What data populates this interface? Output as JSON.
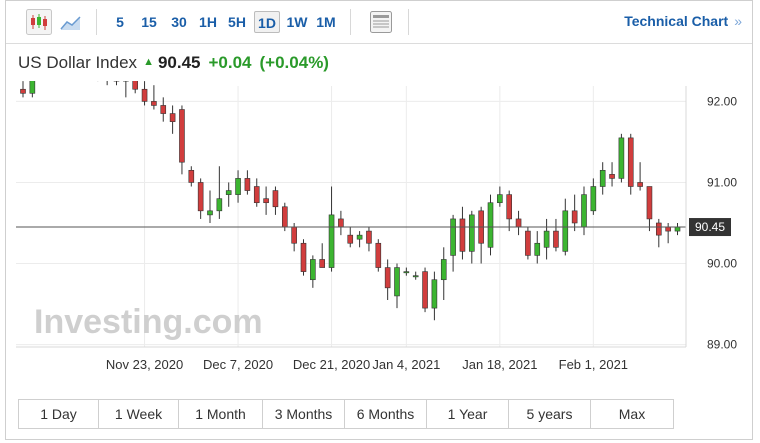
{
  "toolbar": {
    "intervals": [
      "5",
      "15",
      "30",
      "1H",
      "5H",
      "1D",
      "1W",
      "1M"
    ],
    "active_interval": "1D",
    "technical_chart_label": "Technical Chart",
    "technical_chart_arrow": "»"
  },
  "quote": {
    "name": "US Dollar Index",
    "last": "90.45",
    "change": "+0.04",
    "change_pct": "(+0.04%)",
    "up_color": "#2a9a2a"
  },
  "ranges": [
    "1 Day",
    "1 Week",
    "1 Month",
    "3 Months",
    "6 Months",
    "1 Year",
    "5 years",
    "Max"
  ],
  "chart_data": {
    "type": "candlestick",
    "y_ticks": [
      "92.00",
      "91.00",
      "90.00",
      "89.00"
    ],
    "ylim": [
      88.97,
      92.19
    ],
    "x_ticks": [
      "Nov 23, 2020",
      "Dec 7, 2020",
      "Dec 21, 2020",
      "Jan 4, 2021",
      "Jan 18, 2021",
      "Feb 1, 2021"
    ],
    "current_price_label": "90.45",
    "current_price": 90.45,
    "watermark": "Investing.com",
    "up_color": "#3cb531",
    "down_color": "#d13d3d",
    "candles": [
      {
        "date": "Nov 4, 2020",
        "o": 92.15,
        "h": 92.25,
        "l": 92.05,
        "c": 92.1
      },
      {
        "date": "Nov 5, 2020",
        "o": 92.1,
        "h": 92.85,
        "l": 92.05,
        "c": 92.6
      },
      {
        "date": "Nov 6, 2020",
        "o": 92.65,
        "h": 92.9,
        "l": 92.55,
        "c": 92.65
      },
      {
        "date": "Nov 9, 2020",
        "o": 92.65,
        "h": 93.05,
        "l": 92.55,
        "c": 92.9
      },
      {
        "date": "Nov 10, 2020",
        "o": 92.95,
        "h": 93.05,
        "l": 92.8,
        "c": 92.85
      },
      {
        "date": "Nov 11, 2020",
        "o": 92.85,
        "h": 92.95,
        "l": 92.6,
        "c": 92.65
      },
      {
        "date": "Nov 12, 2020",
        "o": 92.65,
        "h": 92.75,
        "l": 92.4,
        "c": 92.5
      },
      {
        "date": "Nov 13, 2020",
        "o": 92.5,
        "h": 92.6,
        "l": 92.3,
        "c": 92.35
      },
      {
        "date": "Nov 16, 2020",
        "o": 92.4,
        "h": 92.45,
        "l": 92.25,
        "c": 92.3
      },
      {
        "date": "Nov 17, 2020",
        "o": 92.35,
        "h": 92.55,
        "l": 92.2,
        "c": 92.45
      },
      {
        "date": "Nov 18, 2020",
        "o": 92.35,
        "h": 92.45,
        "l": 92.2,
        "c": 92.25
      },
      {
        "date": "Nov 19, 2020",
        "o": 92.25,
        "h": 92.7,
        "l": 92.05,
        "c": 92.45
      },
      {
        "date": "Nov 20, 2020",
        "o": 92.5,
        "h": 92.55,
        "l": 92.1,
        "c": 92.15
      },
      {
        "date": "Nov 23, 2020",
        "o": 92.15,
        "h": 92.25,
        "l": 91.95,
        "c": 92.0
      },
      {
        "date": "Nov 24, 2020",
        "o": 92.0,
        "h": 92.2,
        "l": 91.9,
        "c": 91.95
      },
      {
        "date": "Nov 25, 2020",
        "o": 91.95,
        "h": 92.05,
        "l": 91.75,
        "c": 91.85
      },
      {
        "date": "Nov 26, 2020",
        "o": 91.85,
        "h": 91.95,
        "l": 91.6,
        "c": 91.75
      },
      {
        "date": "Nov 27, 2020",
        "o": 91.9,
        "h": 91.95,
        "l": 91.1,
        "c": 91.25
      },
      {
        "date": "Nov 30, 2020",
        "o": 91.15,
        "h": 91.2,
        "l": 90.95,
        "c": 91.0
      },
      {
        "date": "Dec 1, 2020",
        "o": 91.0,
        "h": 91.05,
        "l": 90.55,
        "c": 90.65
      },
      {
        "date": "Dec 2, 2020",
        "o": 90.6,
        "h": 90.9,
        "l": 90.5,
        "c": 90.65
      },
      {
        "date": "Dec 3, 2020",
        "o": 90.65,
        "h": 91.2,
        "l": 90.55,
        "c": 90.8
      },
      {
        "date": "Dec 4, 2020",
        "o": 90.85,
        "h": 91.0,
        "l": 90.7,
        "c": 90.9
      },
      {
        "date": "Dec 7, 2020",
        "o": 90.85,
        "h": 91.15,
        "l": 90.75,
        "c": 91.05
      },
      {
        "date": "Dec 8, 2020",
        "o": 91.05,
        "h": 91.15,
        "l": 90.85,
        "c": 90.9
      },
      {
        "date": "Dec 9, 2020",
        "o": 90.95,
        "h": 91.05,
        "l": 90.7,
        "c": 90.75
      },
      {
        "date": "Dec 10, 2020",
        "o": 90.8,
        "h": 90.95,
        "l": 90.6,
        "c": 90.75
      },
      {
        "date": "Dec 11, 2020",
        "o": 90.9,
        "h": 90.95,
        "l": 90.6,
        "c": 90.7
      },
      {
        "date": "Dec 14, 2020",
        "o": 90.7,
        "h": 90.75,
        "l": 90.4,
        "c": 90.45
      },
      {
        "date": "Dec 15, 2020",
        "o": 90.45,
        "h": 90.5,
        "l": 90.15,
        "c": 90.25
      },
      {
        "date": "Dec 16, 2020",
        "o": 90.25,
        "h": 90.3,
        "l": 89.85,
        "c": 89.9
      },
      {
        "date": "Dec 17, 2020",
        "o": 89.8,
        "h": 90.1,
        "l": 89.7,
        "c": 90.05
      },
      {
        "date": "Dec 18, 2020",
        "o": 90.05,
        "h": 90.25,
        "l": 89.95,
        "c": 89.95
      },
      {
        "date": "Dec 21, 2020",
        "o": 89.95,
        "h": 90.95,
        "l": 89.9,
        "c": 90.6
      },
      {
        "date": "Dec 22, 2020",
        "o": 90.55,
        "h": 90.65,
        "l": 90.35,
        "c": 90.45
      },
      {
        "date": "Dec 23, 2020",
        "o": 90.35,
        "h": 90.45,
        "l": 90.2,
        "c": 90.25
      },
      {
        "date": "Dec 24, 2020",
        "o": 90.3,
        "h": 90.4,
        "l": 90.2,
        "c": 90.35
      },
      {
        "date": "Dec 28, 2020",
        "o": 90.4,
        "h": 90.45,
        "l": 90.15,
        "c": 90.25
      },
      {
        "date": "Dec 29, 2020",
        "o": 90.25,
        "h": 90.3,
        "l": 89.9,
        "c": 89.95
      },
      {
        "date": "Dec 30, 2020",
        "o": 89.95,
        "h": 90.05,
        "l": 89.55,
        "c": 89.7
      },
      {
        "date": "Dec 31, 2020",
        "o": 89.6,
        "h": 90.0,
        "l": 89.45,
        "c": 89.95
      },
      {
        "date": "Jan 4, 2021",
        "o": 89.9,
        "h": 89.95,
        "l": 89.85,
        "c": 89.9
      },
      {
        "date": "Jan 5, 2021",
        "o": 89.85,
        "h": 89.9,
        "l": 89.8,
        "c": 89.85
      },
      {
        "date": "Jan 6, 2021",
        "o": 89.9,
        "h": 89.95,
        "l": 89.4,
        "c": 89.45
      },
      {
        "date": "Jan 7, 2021",
        "o": 89.45,
        "h": 89.9,
        "l": 89.3,
        "c": 89.8
      },
      {
        "date": "Jan 8, 2021",
        "o": 89.8,
        "h": 90.2,
        "l": 89.55,
        "c": 90.05
      },
      {
        "date": "Jan 11, 2021",
        "o": 90.1,
        "h": 90.6,
        "l": 89.9,
        "c": 90.55
      },
      {
        "date": "Jan 12, 2021",
        "o": 90.55,
        "h": 90.7,
        "l": 90.05,
        "c": 90.15
      },
      {
        "date": "Jan 13, 2021",
        "o": 90.15,
        "h": 90.65,
        "l": 90.0,
        "c": 90.6
      },
      {
        "date": "Jan 14, 2021",
        "o": 90.65,
        "h": 90.7,
        "l": 90.0,
        "c": 90.25
      },
      {
        "date": "Jan 15, 2021",
        "o": 90.2,
        "h": 90.85,
        "l": 90.1,
        "c": 90.75
      },
      {
        "date": "Jan 18, 2021",
        "o": 90.75,
        "h": 90.95,
        "l": 90.7,
        "c": 90.85
      },
      {
        "date": "Jan 19, 2021",
        "o": 90.85,
        "h": 90.9,
        "l": 90.4,
        "c": 90.55
      },
      {
        "date": "Jan 20, 2021",
        "o": 90.55,
        "h": 90.65,
        "l": 90.35,
        "c": 90.45
      },
      {
        "date": "Jan 21, 2021",
        "o": 90.4,
        "h": 90.45,
        "l": 90.05,
        "c": 90.1
      },
      {
        "date": "Jan 22, 2021",
        "o": 90.1,
        "h": 90.4,
        "l": 90.0,
        "c": 90.25
      },
      {
        "date": "Jan 25, 2021",
        "o": 90.2,
        "h": 90.55,
        "l": 90.05,
        "c": 90.4
      },
      {
        "date": "Jan 26, 2021",
        "o": 90.4,
        "h": 90.55,
        "l": 90.15,
        "c": 90.2
      },
      {
        "date": "Jan 27, 2021",
        "o": 90.15,
        "h": 90.8,
        "l": 90.1,
        "c": 90.65
      },
      {
        "date": "Jan 28, 2021",
        "o": 90.65,
        "h": 90.85,
        "l": 90.4,
        "c": 90.5
      },
      {
        "date": "Jan 29, 2021",
        "o": 90.45,
        "h": 90.95,
        "l": 90.35,
        "c": 90.85
      },
      {
        "date": "Feb 1, 2021",
        "o": 90.65,
        "h": 91.05,
        "l": 90.6,
        "c": 90.95
      },
      {
        "date": "Feb 2, 2021",
        "o": 90.95,
        "h": 91.25,
        "l": 90.85,
        "c": 91.15
      },
      {
        "date": "Feb 3, 2021",
        "o": 91.1,
        "h": 91.25,
        "l": 90.95,
        "c": 91.05
      },
      {
        "date": "Feb 4, 2021",
        "o": 91.05,
        "h": 91.6,
        "l": 91.0,
        "c": 91.55
      },
      {
        "date": "Feb 5, 2021",
        "o": 91.55,
        "h": 91.6,
        "l": 90.85,
        "c": 90.95
      },
      {
        "date": "Feb 8, 2021",
        "o": 91.0,
        "h": 91.25,
        "l": 90.9,
        "c": 90.95
      },
      {
        "date": "Feb 9, 2021",
        "o": 90.95,
        "h": 90.95,
        "l": 90.4,
        "c": 90.55
      },
      {
        "date": "Feb 10, 2021",
        "o": 90.5,
        "h": 90.55,
        "l": 90.2,
        "c": 90.35
      },
      {
        "date": "Feb 11, 2021",
        "o": 90.45,
        "h": 90.5,
        "l": 90.25,
        "c": 90.4
      },
      {
        "date": "Feb 12, 2021",
        "o": 90.4,
        "h": 90.5,
        "l": 90.35,
        "c": 90.45
      }
    ]
  }
}
